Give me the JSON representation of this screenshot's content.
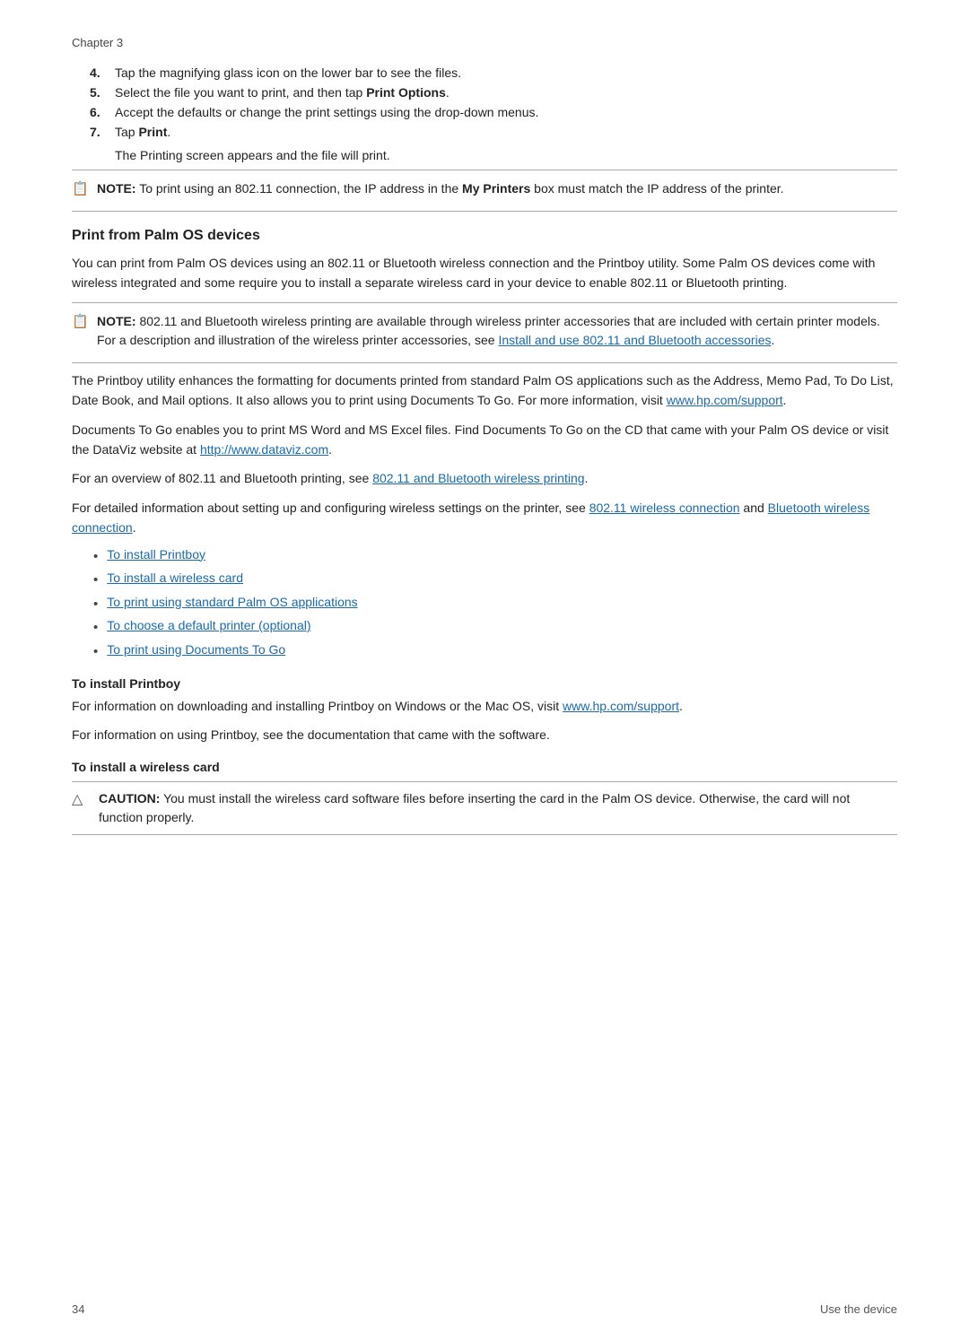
{
  "chapter": "Chapter 3",
  "steps": [
    {
      "num": "4.",
      "text": "Tap the magnifying glass icon on the lower bar to see the files."
    },
    {
      "num": "5.",
      "text_before": "Select the file you want to print, and then tap ",
      "bold": "Print Options",
      "text_after": "."
    },
    {
      "num": "6.",
      "text": "Accept the defaults or change the print settings using the drop-down menus."
    },
    {
      "num": "7.",
      "text_before": "Tap ",
      "bold": "Print",
      "text_after": "."
    }
  ],
  "step7_subtext": "The Printing screen appears and the file will print.",
  "note1": {
    "label": "NOTE:",
    "text_before": "  To print using an 802.11 connection, the IP address in the ",
    "bold": "My Printers",
    "text_after": " box must match the IP address of the printer."
  },
  "print_from_palm": {
    "heading": "Print from Palm OS devices",
    "para1": "You can print from Palm OS devices using an 802.11 or Bluetooth wireless connection and the Printboy utility. Some Palm OS devices come with wireless integrated and some require you to install a separate wireless card in your device to enable 802.11 or Bluetooth printing.",
    "note2": {
      "label": "NOTE:",
      "text": "  802.11 and Bluetooth wireless printing are available through wireless printer accessories that are included with certain printer models. For a description and illustration of the wireless printer accessories, see ",
      "link_text": "Install and use 802.11 and Bluetooth accessories",
      "text_after": "."
    },
    "para2_before": "The Printboy utility enhances the formatting for documents printed from standard Palm OS applications such as the Address, Memo Pad, To Do List, Date Book, and Mail options. It also allows you to print using Documents To Go. For more information, visit ",
    "para2_link": "www.hp.com/support",
    "para2_after": ".",
    "para3_before": "Documents To Go enables you to print MS Word and MS Excel files. Find Documents To Go on the CD that came with your Palm OS device or visit the DataViz website at ",
    "para3_link": "http://www.dataviz.com",
    "para3_after": ".",
    "para4_before": "For an overview of 802.11 and Bluetooth printing, see ",
    "para4_link": "802.11 and Bluetooth wireless printing",
    "para4_after": ".",
    "para5_before": "For detailed information about setting up and configuring wireless settings on the printer, see ",
    "para5_link1": "802.11 wireless connection",
    "para5_mid": " and ",
    "para5_link2": "Bluetooth wireless connection",
    "para5_after": ".",
    "bullets": [
      "To install Printboy",
      "To install a wireless card",
      "To print using standard Palm OS applications",
      "To choose a default printer (optional)",
      "To print using Documents To Go"
    ],
    "install_printboy": {
      "heading": "To install Printboy",
      "para1_before": "For information on downloading and installing Printboy on Windows or the Mac OS, visit ",
      "para1_link": "www.hp.com/support",
      "para1_after": ".",
      "para2": "For information on using Printboy, see the documentation that came with the software."
    },
    "install_wireless": {
      "heading": "To install a wireless card",
      "caution_label": "CAUTION:",
      "caution_text": "  You must install the wireless card software files before inserting the card in the Palm OS device. Otherwise, the card will not function properly."
    }
  },
  "footer": {
    "page_num": "34",
    "page_label": "Use the device"
  }
}
